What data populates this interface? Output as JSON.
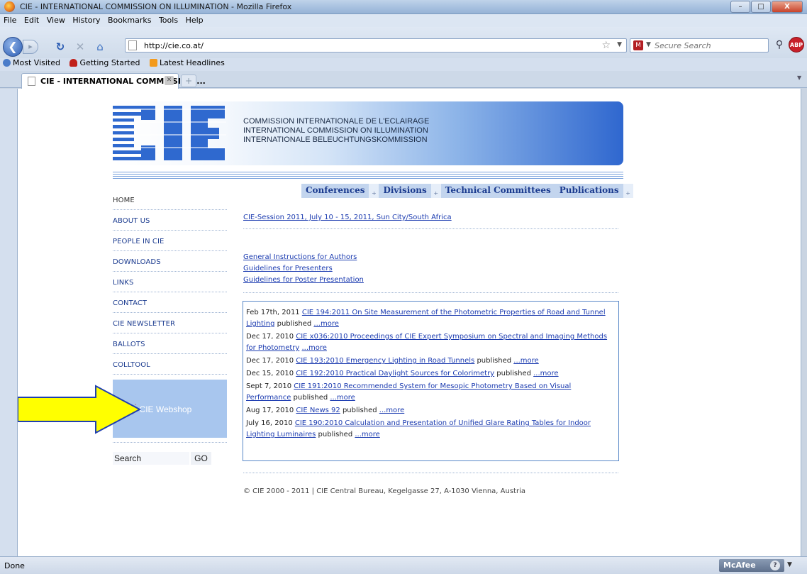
{
  "window": {
    "title": "CIE - INTERNATIONAL COMMISSION ON ILLUMINATION - Mozilla Firefox",
    "controls": {
      "minimize": "–",
      "maximize": "□",
      "close": "X"
    }
  },
  "menu": [
    "File",
    "Edit",
    "View",
    "History",
    "Bookmarks",
    "Tools",
    "Help"
  ],
  "navigation": {
    "url": "http://cie.co.at/",
    "search_placeholder": "Secure Search",
    "search_engine_label": "M",
    "abp_label": "ABP"
  },
  "bookmarks": [
    {
      "label": "Most Visited",
      "color": "#4a7cc9"
    },
    {
      "label": "Getting Started",
      "color": "#c0201a"
    },
    {
      "label": "Latest Headlines",
      "color": "#f39a1c"
    }
  ],
  "tab": {
    "title": "CIE - INTERNATIONAL COMMISSION ...",
    "new_tab": "+"
  },
  "page": {
    "banner_lines": [
      "COMMISSION INTERNATIONALE DE L'ECLAIRAGE",
      "INTERNATIONAL COMMISSION ON ILLUMINATION",
      "INTERNATIONALE BELEUCHTUNGSKOMMISSION"
    ],
    "topnav": [
      "Conferences",
      "Divisions",
      "Technical Committees",
      "Publications"
    ],
    "topnav_plus": "+",
    "sidenav": [
      "HOME",
      "ABOUT US",
      "PEOPLE IN CIE",
      "DOWNLOADS",
      "LINKS",
      "CONTACT",
      "CIE NEWSLETTER",
      "BALLOTS",
      "COLLTOOL"
    ],
    "webshop_label": "CIE Webshop",
    "webshop_icon": "shopping-cart-icon",
    "search_value": "Search",
    "search_button": "GO",
    "session_link": "CIE-Session 2011, July 10 - 15, 2011, Sun City/South Africa",
    "author_links": [
      "General Instructions for Authors",
      "Guidelines for Presenters",
      "Guidelines for Poster Presentation"
    ],
    "news": [
      {
        "date": "Feb 17th, 2011 ",
        "link": "CIE 194:2011 On Site Measurement of the Photometric Properties of Road and Tunnel Lighting",
        "tail": " published ",
        "more": "...more"
      },
      {
        "date": "Dec 17, 2010 ",
        "link": "CIE x036:2010  Proceedings of CIE Expert Symposium on Spectral and Imaging Methods for Photometry",
        "tail": " ",
        "more": "...more"
      },
      {
        "date": "Dec 17, 2010 ",
        "link": "CIE 193:2010 Emergency Lighting in Road Tunnels",
        "tail": " published ",
        "more": "...more"
      },
      {
        "date": "Dec 15, 2010 ",
        "link": "CIE 192:2010 Practical Daylight Sources for Colorimetry",
        "tail": " published ",
        "more": "...more"
      },
      {
        "date": "Sept 7, 2010 ",
        "link": "CIE 191:2010 Recommended System for Mesopic Photometry Based on Visual Performance",
        "tail": " published ",
        "more": "...more"
      },
      {
        "date": "Aug 17, 2010 ",
        "link": "CIE News 92",
        "tail": " published ",
        "more": "...more"
      },
      {
        "date": "July 16, 2010 ",
        "link": "CIE 190:2010 Calculation and Presentation of Unified Glare Rating Tables for Indoor Lighting Luminaires",
        "tail": " published ",
        "more": "...more"
      }
    ],
    "footer": "© CIE 2000 - 2011 | CIE Central Bureau, Kegelgasse 27, A-1030 Vienna, Austria"
  },
  "statusbar": {
    "status": "Done",
    "mcafee": "McAfee",
    "help": "?"
  },
  "colors": {
    "link": "#1b3bb0",
    "nav_bg": "#c3d5ee",
    "webshop_bg": "#a8c6ee",
    "arrow_fill": "#ffff00",
    "arrow_stroke": "#1f3fb0"
  }
}
